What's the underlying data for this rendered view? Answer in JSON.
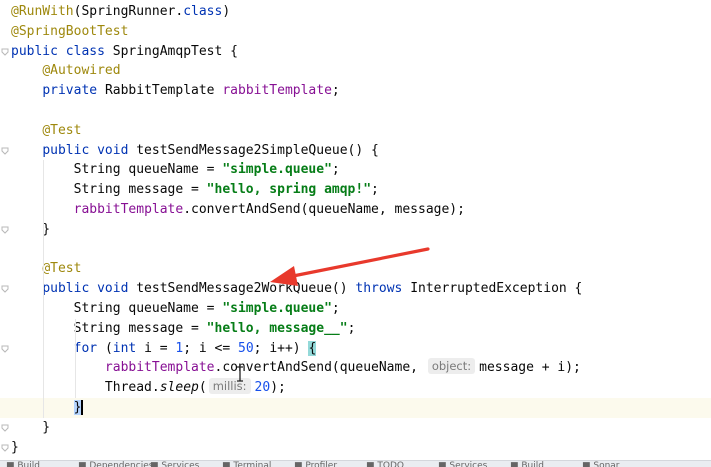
{
  "editor": {
    "lines": [
      {
        "parts": [
          {
            "t": "@RunWith",
            "c": "ann"
          },
          {
            "t": "(SpringRunner."
          },
          {
            "t": "class",
            "c": "kw"
          },
          {
            "t": ")"
          }
        ]
      },
      {
        "parts": [
          {
            "t": "@SpringBootTest",
            "c": "ann"
          }
        ]
      },
      {
        "parts": [
          {
            "t": "public class ",
            "c": "kw"
          },
          {
            "t": "SpringAmqpTest {"
          }
        ]
      },
      {
        "parts": [
          {
            "t": "    "
          },
          {
            "t": "@Autowired",
            "c": "ann"
          }
        ]
      },
      {
        "parts": [
          {
            "t": "    "
          },
          {
            "t": "private ",
            "c": "kw"
          },
          {
            "t": "RabbitTemplate "
          },
          {
            "t": "rabbitTemplate",
            "c": "fld"
          },
          {
            "t": ";"
          }
        ]
      },
      {
        "parts": []
      },
      {
        "parts": [
          {
            "t": "    "
          },
          {
            "t": "@Test",
            "c": "ann"
          }
        ]
      },
      {
        "parts": [
          {
            "t": "    "
          },
          {
            "t": "public void ",
            "c": "kw"
          },
          {
            "t": "testSendMessage2SimpleQueue() {"
          }
        ]
      },
      {
        "parts": [
          {
            "t": "        String queueName = "
          },
          {
            "t": "\"simple.queue\"",
            "c": "str"
          },
          {
            "t": ";"
          }
        ]
      },
      {
        "parts": [
          {
            "t": "        String message = "
          },
          {
            "t": "\"hello, spring amqp!\"",
            "c": "str"
          },
          {
            "t": ";"
          }
        ]
      },
      {
        "parts": [
          {
            "t": "        "
          },
          {
            "t": "rabbitTemplate",
            "c": "fld"
          },
          {
            "t": ".convertAndSend(queueName, message);"
          }
        ]
      },
      {
        "parts": [
          {
            "t": "    }"
          }
        ]
      },
      {
        "parts": []
      },
      {
        "parts": [
          {
            "t": "    "
          },
          {
            "t": "@Test",
            "c": "ann"
          }
        ]
      },
      {
        "parts": [
          {
            "t": "    "
          },
          {
            "t": "public void ",
            "c": "kw"
          },
          {
            "t": "testSendMessage2WorkQueue() "
          },
          {
            "t": "throws ",
            "c": "kw"
          },
          {
            "t": "InterruptedException {"
          }
        ]
      },
      {
        "parts": [
          {
            "t": "        String queueName = "
          },
          {
            "t": "\"simple.queue\"",
            "c": "str"
          },
          {
            "t": ";"
          }
        ]
      },
      {
        "parts": [
          {
            "t": "        String message = "
          },
          {
            "t": "\"hello, message__\"",
            "c": "str"
          },
          {
            "t": ";"
          }
        ]
      },
      {
        "parts": [
          {
            "t": "        "
          },
          {
            "t": "for ",
            "c": "kw"
          },
          {
            "t": "("
          },
          {
            "t": "int ",
            "c": "kw"
          },
          {
            "t": "i = "
          },
          {
            "t": "1",
            "c": "num"
          },
          {
            "t": "; i <= "
          },
          {
            "t": "50",
            "c": "num"
          },
          {
            "t": "; i++) "
          },
          {
            "t": "{",
            "c": "brace-hl"
          }
        ]
      },
      {
        "parts": [
          {
            "t": "            "
          },
          {
            "t": "rabbitTemplate",
            "c": "fld"
          },
          {
            "t": ".convertAndSend(queueName, "
          },
          {
            "t": "object:",
            "c": "hint"
          },
          {
            "t": "message + i);"
          }
        ]
      },
      {
        "parts": [
          {
            "t": "            Thread."
          },
          {
            "t": "sleep",
            "c": "call"
          },
          {
            "t": "("
          },
          {
            "t": "millis:",
            "c": "hint"
          },
          {
            "t": "20",
            "c": "num"
          },
          {
            "t": ");"
          }
        ]
      },
      {
        "parts": [
          {
            "t": "        "
          },
          {
            "t": "}",
            "c": "caret-brace"
          }
        ],
        "current": true
      },
      {
        "parts": [
          {
            "t": "    }"
          }
        ]
      },
      {
        "parts": [
          {
            "t": "}"
          }
        ]
      }
    ]
  },
  "toolbar": {
    "items": [
      "Build",
      "Dependencies",
      "Services",
      "Terminal",
      "Profiler",
      "TODO",
      "Services",
      "Build",
      "Sonar"
    ]
  },
  "colors": {
    "annotation": "#9e880d",
    "keyword": "#0033b3",
    "field": "#871094",
    "string": "#067d17",
    "number": "#1750eb",
    "arrow": "#e8392c"
  }
}
